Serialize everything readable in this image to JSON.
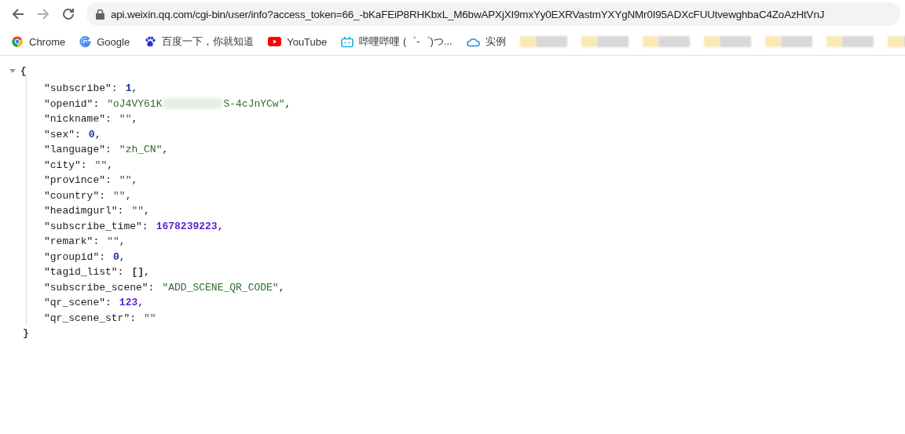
{
  "address_bar": {
    "url": "api.weixin.qq.com/cgi-bin/user/info?access_token=66_-bKaFEiP8RHKbxL_M6bwAPXjXI9mxYy0EXRVastmYXYgNMr0I95ADXcFUUtvewghbaC4ZoAzHtVnJ"
  },
  "bookmarks": [
    {
      "kind": "chrome",
      "label": "Chrome"
    },
    {
      "kind": "google",
      "label": "Google"
    },
    {
      "kind": "paw",
      "label": "百度一下，你就知道"
    },
    {
      "kind": "youtube",
      "label": "YouTube"
    },
    {
      "kind": "tv",
      "label": "哔哩哔哩 (゜-゜)つ..."
    },
    {
      "kind": "cloud",
      "label": "实例"
    }
  ],
  "json_view": {
    "open_brace": "{",
    "close_brace": "}",
    "expanded": true,
    "lines": [
      {
        "key": "\"subscribe\":",
        "kind": "number",
        "parts": [
          "1"
        ],
        "punct": ","
      },
      {
        "key": "\"openid\":",
        "kind": "string",
        "parts": [
          "\"oJ4VY61K",
          "S-4cJnYCw\""
        ],
        "punct": ","
      },
      {
        "key": "\"nickname\":",
        "kind": "string",
        "parts": [
          "\"\""
        ],
        "punct": ","
      },
      {
        "key": "\"sex\":",
        "kind": "number",
        "parts": [
          "0"
        ],
        "punct": ","
      },
      {
        "key": "\"language\":",
        "kind": "string",
        "parts": [
          "\"zh_CN\""
        ],
        "punct": ","
      },
      {
        "key": "\"city\":",
        "kind": "string",
        "parts": [
          "\"\""
        ],
        "punct": ","
      },
      {
        "key": "\"province\":",
        "kind": "string",
        "parts": [
          "\"\""
        ],
        "punct": ","
      },
      {
        "key": "\"country\":",
        "kind": "string",
        "parts": [
          "\"\""
        ],
        "punct": ","
      },
      {
        "key": "\"headimgurl\":",
        "kind": "string",
        "parts": [
          "\"\""
        ],
        "punct": ","
      },
      {
        "key": "\"subscribe_time\":",
        "kind": "bignumber",
        "parts": [
          "1678239223"
        ],
        "punct": ","
      },
      {
        "key": "\"remark\":",
        "kind": "string",
        "parts": [
          "\"\""
        ],
        "punct": ","
      },
      {
        "key": "\"groupid\":",
        "kind": "number",
        "parts": [
          "0"
        ],
        "punct": ","
      },
      {
        "key": "\"tagid_list\":",
        "kind": "array",
        "parts": [
          "[]"
        ],
        "punct": ","
      },
      {
        "key": "\"subscribe_scene\":",
        "kind": "string",
        "parts": [
          "\"ADD_SCENE_QR_CODE\""
        ],
        "punct": ","
      },
      {
        "key": "\"qr_scene\":",
        "kind": "bignumber",
        "parts": [
          "123"
        ],
        "punct": ","
      },
      {
        "key": "\"qr_scene_str\":",
        "kind": "string",
        "parts": [
          "\"\""
        ]
      }
    ]
  }
}
